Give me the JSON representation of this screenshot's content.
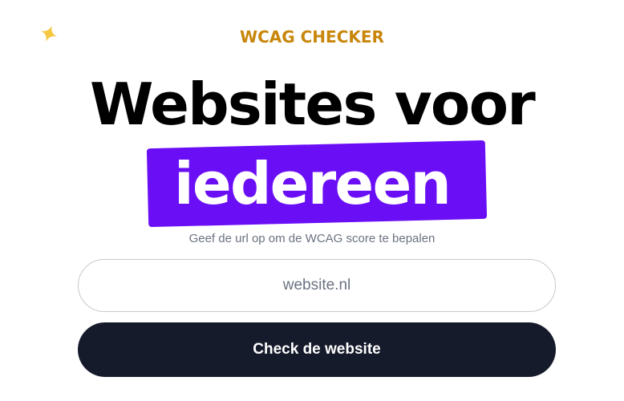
{
  "brand": {
    "eyebrow": "WCAG CHECKER",
    "sparkle_icon": "sparkle-icon"
  },
  "hero": {
    "headline": "Websites voor",
    "highlight": "iedereen",
    "subtitle": "Geef de url op om de WCAG score te bepalen"
  },
  "form": {
    "url_placeholder": "website.nl",
    "url_value": "",
    "submit_label": "Check de website"
  },
  "colors": {
    "eyebrow": "#c8860b",
    "highlight_bg": "#6a0ef5",
    "button_bg": "#161b2b",
    "sparkle": "#f5c842"
  }
}
